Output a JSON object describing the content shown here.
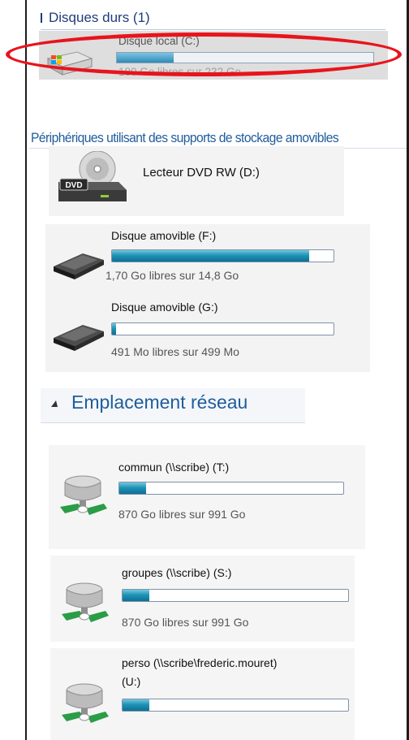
{
  "hard_drives": {
    "group_title": "Disques durs (1)",
    "drive": {
      "name": "Disque local (C:)",
      "free_text": "180 Go libres sur 232 Go",
      "used_fraction": 0.22,
      "icon": "windows-hard-drive-icon"
    }
  },
  "removable": {
    "group_title": "Périphériques utilisant des supports de stockage amovibles",
    "dvd": {
      "name": "Lecteur DVD RW (D:)",
      "icon": "dvd-drive-icon",
      "badge": "DVD"
    },
    "usb": [
      {
        "name": "Disque amovible (F:)",
        "free_text": "1,70 Go libres sur 14,8 Go",
        "used_fraction": 0.89,
        "icon": "usb-drive-icon"
      },
      {
        "name": "Disque amovible (G:)",
        "free_text": "491 Mo libres sur 499 Mo",
        "used_fraction": 0.02,
        "icon": "usb-drive-icon"
      }
    ]
  },
  "network": {
    "group_title": "Emplacement réseau",
    "drives": [
      {
        "name": "commun (\\\\scribe) (T:)",
        "free_text": "870 Go libres sur 991 Go",
        "used_fraction": 0.12,
        "icon": "network-drive-icon"
      },
      {
        "name": "groupes (\\\\scribe) (S:)",
        "free_text": "870 Go libres sur 991 Go",
        "used_fraction": 0.12,
        "icon": "network-drive-icon"
      },
      {
        "name": "perso (\\\\scribe\\frederic.mouret)",
        "name_line2": "(U:)",
        "used_fraction": 0.12,
        "icon": "network-drive-icon"
      }
    ]
  },
  "colors": {
    "accent_blue": "#1f5d9c",
    "highlight_red": "#e8141c",
    "bar_fill": "#1f93b6"
  }
}
